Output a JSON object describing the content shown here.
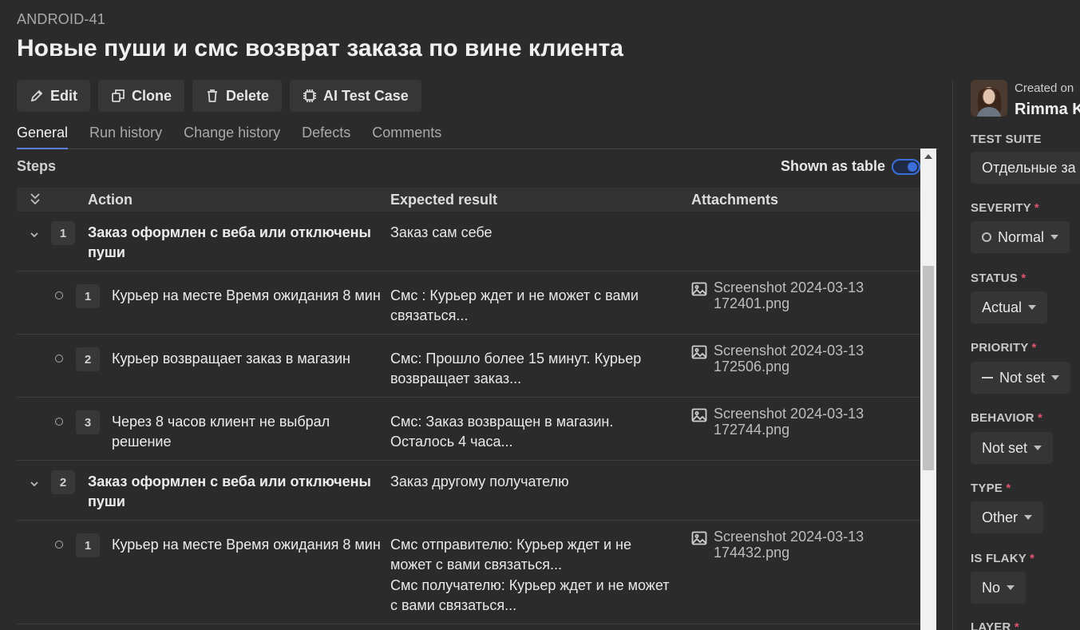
{
  "header": {
    "case_key": "ANDROID-41",
    "title": "Новые пуши и смс возврат заказа по вине клиента"
  },
  "toolbar": {
    "edit": "Edit",
    "clone": "Clone",
    "delete": "Delete",
    "ai": "AI Test Case"
  },
  "tabs": [
    "General",
    "Run history",
    "Change history",
    "Defects",
    "Comments"
  ],
  "steps": {
    "label": "Steps",
    "toggle_label": "Shown as table",
    "toggle_on": true,
    "columns": {
      "action": "Action",
      "expected": "Expected result",
      "attachments": "Attachments"
    },
    "rows": [
      {
        "num": "1",
        "action": "Заказ оформлен с веба или отключены пуши",
        "expected": "Заказ сам себе"
      },
      {
        "num": "1",
        "action": "Курьер на месте Время ожидания 8 мин",
        "expected": "Смс : Курьер ждет и не может с вами связаться...",
        "attachment": "Screenshot 2024-03-13 172401.png"
      },
      {
        "num": "2",
        "action": "Курьер возвращает заказ в магазин",
        "expected": "Смс: Прошло более 15 минут. Курьер возвращает заказ...",
        "attachment": "Screenshot 2024-03-13 172506.png"
      },
      {
        "num": "3",
        "action": "Через 8 часов клиент не выбрал решение",
        "expected": "Смс: Заказ возвращен в магазин. Осталось 4 часа...",
        "attachment": "Screenshot 2024-03-13 172744.png"
      },
      {
        "num": "2",
        "action": "Заказ оформлен с веба или отключены пуши",
        "expected": "Заказ другому получателю"
      },
      {
        "num": "1",
        "action": "Курьер на месте Время ожидания 8 мин",
        "expected": "Смс отправителю: Курьер ждет и не может с вами связаться...",
        "expected2": "Смс получателю: Курьер ждет и не может с вами связаться...",
        "attachment": "Screenshot 2024-03-13 174432.png"
      }
    ]
  },
  "sidebar": {
    "created_label": "Created on",
    "author": "Rimma K",
    "test_suite_label": "TEST SUITE",
    "test_suite_value": "Отдельные за",
    "severity_label": "SEVERITY",
    "severity_value": "Normal",
    "status_label": "STATUS",
    "status_value": "Actual",
    "priority_label": "PRIORITY",
    "priority_value": "Not set",
    "behavior_label": "BEHAVIOR",
    "behavior_value": "Not set",
    "type_label": "TYPE",
    "type_value": "Other",
    "flaky_label": "IS FLAKY",
    "flaky_value": "No",
    "layer_label": "LAYER",
    "required_mark": "*"
  },
  "colors": {
    "accent": "#3b6fd8",
    "required": "#e0546b",
    "background": "#2b2b2b"
  }
}
